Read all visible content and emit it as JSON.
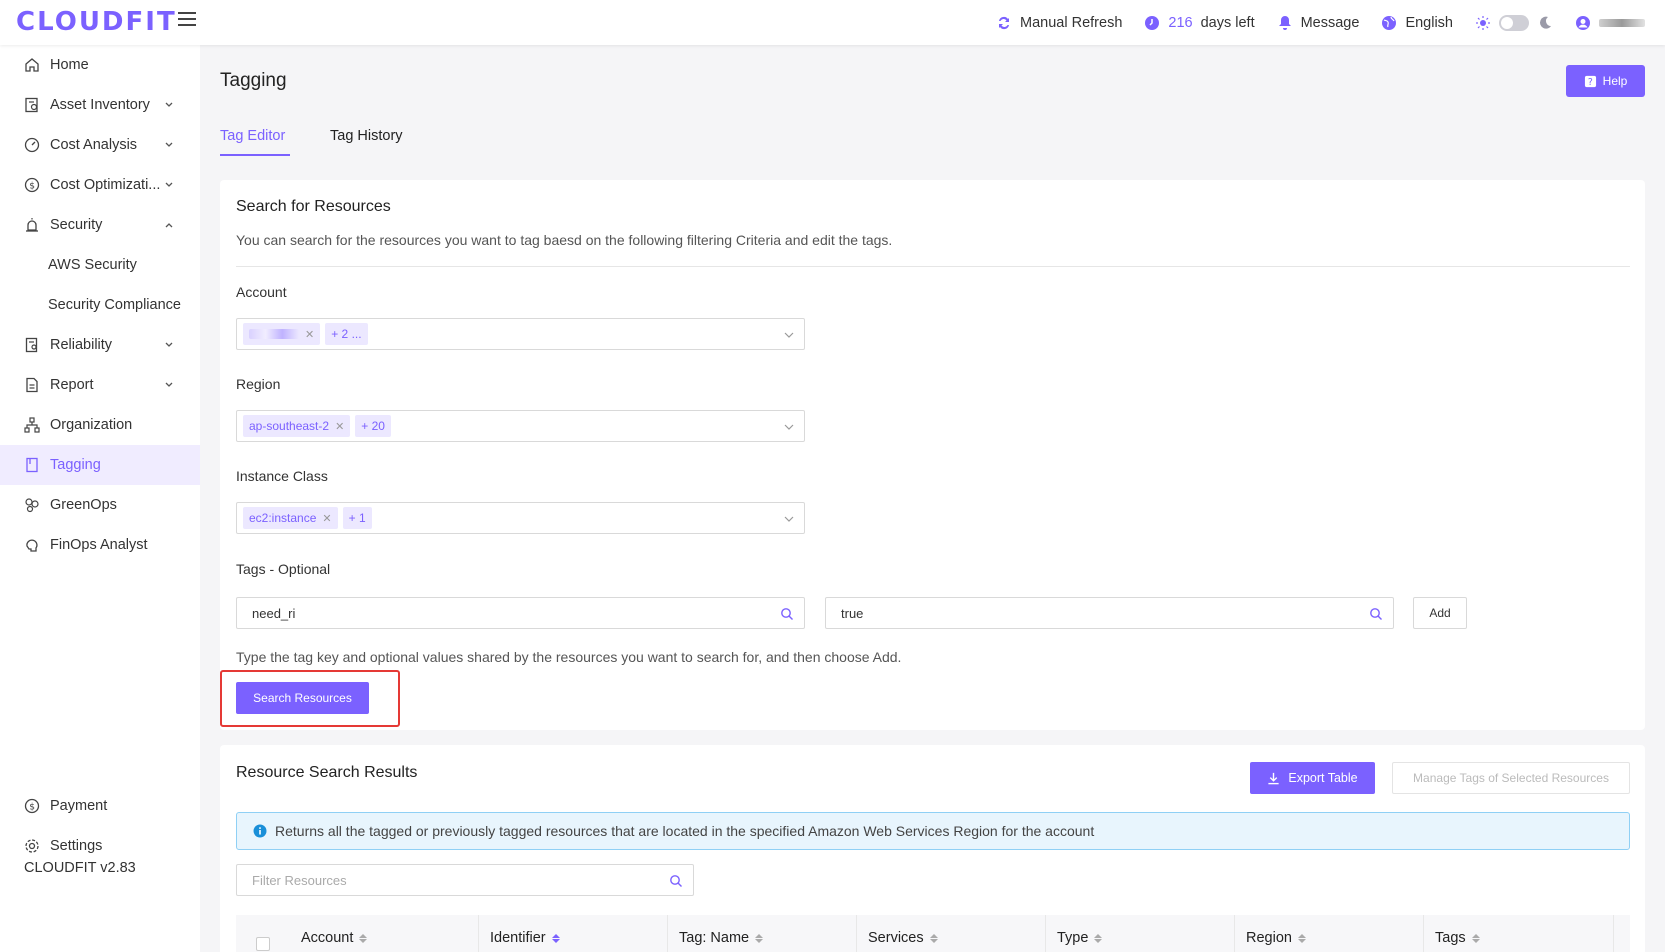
{
  "app": {
    "logo": "CLOUDFIT",
    "accent_color": "#7b61ff"
  },
  "topbar": {
    "refresh_label": "Manual Refresh",
    "days_count": "216",
    "days_suffix": "days left",
    "message_label": "Message",
    "language_label": "English"
  },
  "sidebar": {
    "items": [
      {
        "label": "Home",
        "icon": "home-icon"
      },
      {
        "label": "Asset Inventory",
        "icon": "inventory-icon"
      },
      {
        "label": "Cost Analysis",
        "icon": "gauge-icon"
      },
      {
        "label": "Cost Optimizati...",
        "icon": "dollar-icon"
      },
      {
        "label": "Security",
        "icon": "alarm-icon"
      },
      {
        "label": "AWS Security"
      },
      {
        "label": "Security Compliance"
      },
      {
        "label": "Reliability",
        "icon": "document-icon"
      },
      {
        "label": "Report",
        "icon": "report-icon"
      },
      {
        "label": "Organization",
        "icon": "org-icon"
      },
      {
        "label": "Tagging",
        "icon": "tag-icon"
      },
      {
        "label": "GreenOps",
        "icon": "leaf-icon"
      },
      {
        "label": "FinOps Analyst",
        "icon": "brain-icon"
      },
      {
        "label": "Payment",
        "icon": "payment-icon"
      },
      {
        "label": "Settings",
        "icon": "gear-icon"
      }
    ],
    "version": "CLOUDFIT v2.83"
  },
  "page": {
    "title": "Tagging",
    "help_label": "Help",
    "tabs": [
      {
        "label": "Tag Editor"
      },
      {
        "label": "Tag History"
      }
    ]
  },
  "search": {
    "title": "Search for Resources",
    "description": "You can search for the resources you want to tag baesd on the following filtering Criteria and edit the tags.",
    "account_label": "Account",
    "account_more": "+ 2 ...",
    "region_label": "Region",
    "region_chip": "ap-southeast-2",
    "region_more": "+ 20",
    "instance_label": "Instance Class",
    "instance_chip": "ec2:instance",
    "instance_more": "+ 1",
    "tags_label": "Tags - Optional",
    "tag_key": "need_ri",
    "tag_value": "true",
    "add_label": "Add",
    "hint": "Type the tag key and optional values shared by the resources you want to search for, and then choose Add.",
    "search_button": "Search Resources"
  },
  "results": {
    "title": "Resource Search Results",
    "export_label": "Export Table",
    "manage_label": "Manage Tags of Selected Resources",
    "info": "Returns all the tagged or previously tagged resources that are located in the specified Amazon Web Services Region for the account",
    "filter_placeholder": "Filter Resources",
    "columns": [
      "Account",
      "Identifier",
      "Tag: Name",
      "Services",
      "Type",
      "Region",
      "Tags"
    ]
  }
}
